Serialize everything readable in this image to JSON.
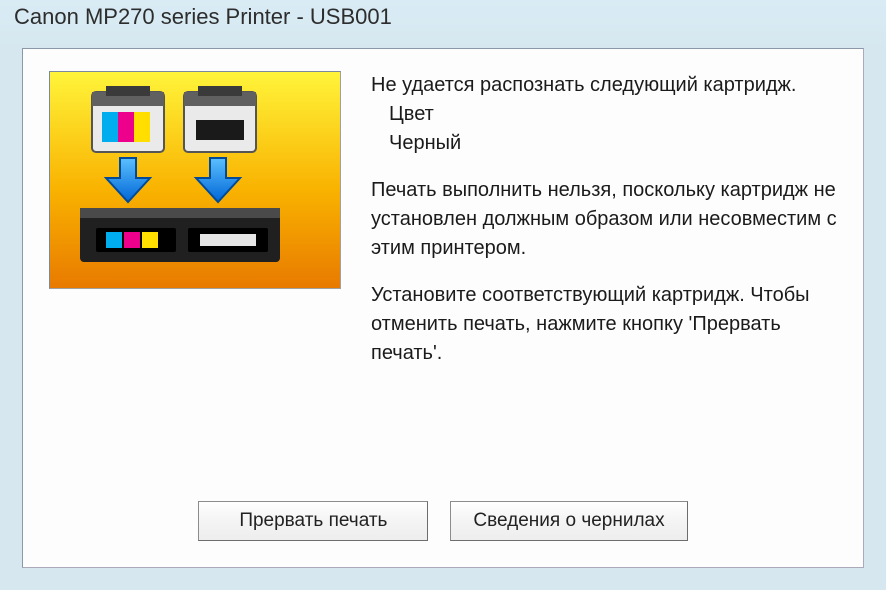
{
  "window": {
    "title": "Canon MP270 series Printer - USB001"
  },
  "message": {
    "line1": "Не удается распознать следующий картридж.",
    "color_line": "Цвет",
    "black_line": "Черный",
    "para2": "Печать выполнить нельзя, поскольку картридж не установлен должным образом или несовместим с этим принтером.",
    "para3": "Установите соответствующий картридж. Чтобы отменить печать, нажмите кнопку 'Прервать печать'."
  },
  "buttons": {
    "cancel_print": "Прервать печать",
    "ink_info": "Сведения о чернилах"
  }
}
